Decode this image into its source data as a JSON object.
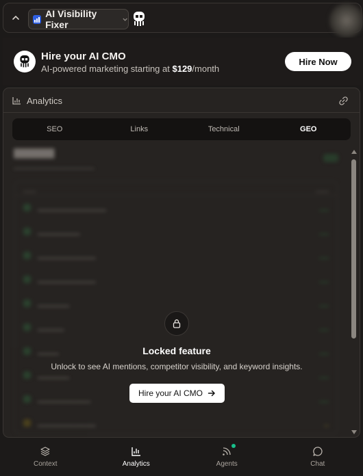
{
  "topbar": {
    "app_name": "AI Visibility Fixer",
    "icons": [
      "chevron-up-icon",
      "bar-chart-icon",
      "chevron-down-icon",
      "mascot-icon"
    ]
  },
  "promo": {
    "title": "Hire your AI CMO",
    "subtitle_prefix": "AI-powered marketing starting at ",
    "price": "$129",
    "subtitle_suffix": "/month",
    "button_label": "Hire Now"
  },
  "panel": {
    "title": "Analytics",
    "icons": [
      "bar-chart-icon",
      "link-icon"
    ],
    "tabs": [
      {
        "label": "SEO",
        "active": false
      },
      {
        "label": "Links",
        "active": false
      },
      {
        "label": "Technical",
        "active": false
      },
      {
        "label": "GEO",
        "active": true
      }
    ]
  },
  "locked": {
    "title": "Locked feature",
    "description": "Unlock to see AI mentions, competitor visibility, and keyword insights.",
    "button_label": "Hire your AI CMO"
  },
  "bottom_nav": [
    {
      "label": "Context",
      "icon": "layers-icon",
      "active": false
    },
    {
      "label": "Analytics",
      "icon": "bar-chart-icon",
      "active": true
    },
    {
      "label": "Agents",
      "icon": "rss-icon",
      "active": false,
      "notification": true
    },
    {
      "label": "Chat",
      "icon": "message-circle-icon",
      "active": false
    }
  ],
  "colors": {
    "background": "#1c1a19",
    "panel": "#262321",
    "accent_blue": "#2f5fe0",
    "notification": "#18c08a"
  }
}
